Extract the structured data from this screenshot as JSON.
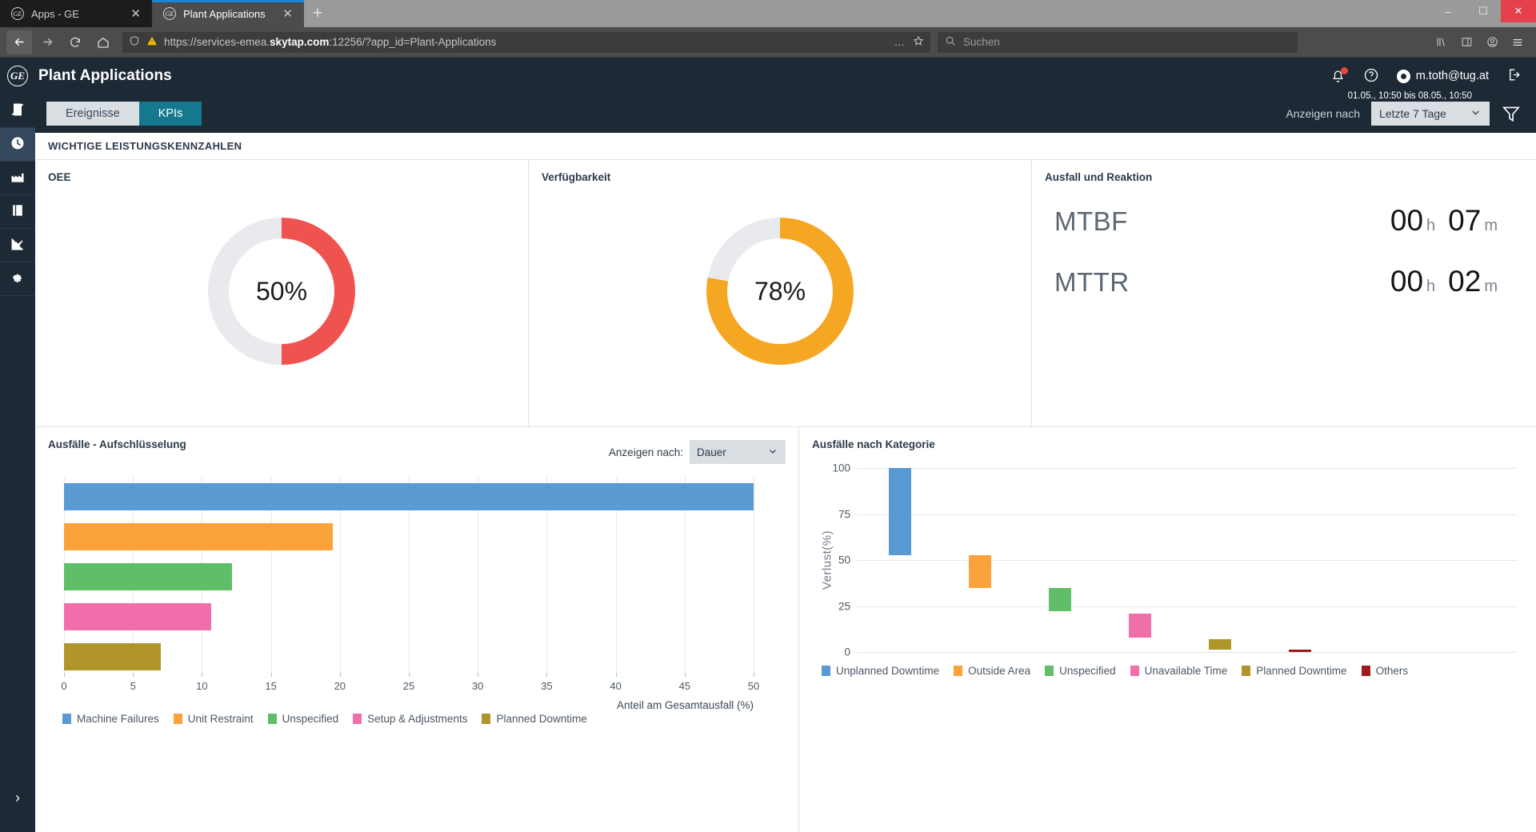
{
  "browser": {
    "tabs": [
      {
        "title": "Apps - GE",
        "favicon": "ge-icon",
        "active": false
      },
      {
        "title": "Plant Applications",
        "favicon": "ge-icon",
        "active": true
      }
    ],
    "new_tab_label": "+",
    "window_controls": {
      "minimize": "–",
      "maximize": "☐",
      "close": "✕"
    },
    "nav": {
      "back": "back-arrow-icon",
      "forward": "forward-arrow-icon",
      "reload": "reload-icon",
      "home": "home-icon"
    },
    "url": {
      "prefix": "https://services-emea.",
      "host": "skytap.com",
      "suffix": ":12256/?app_id=Plant-Applications",
      "full": "https://services-emea.skytap.com:12256/?app_id=Plant-Applications",
      "shield_icon": "shield-icon",
      "warning_icon": "warning-triangle-icon",
      "more_icon": "ellipsis-icon",
      "bookmark_icon": "star-icon"
    },
    "search": {
      "placeholder": "Suchen",
      "icon": "search-icon"
    },
    "toolbar_icons": [
      "library-icon",
      "sidebar-icon",
      "account-icon",
      "menu-icon"
    ]
  },
  "sidebar": {
    "logo": "ge-logo",
    "items": [
      {
        "name": "clipboard",
        "icon": "clipboard-pen-icon",
        "active": false
      },
      {
        "name": "time",
        "icon": "clock-icon",
        "active": true
      },
      {
        "name": "plant",
        "icon": "factory-icon",
        "active": false
      },
      {
        "name": "reports",
        "icon": "book-icon",
        "active": false
      },
      {
        "name": "analysis",
        "icon": "chart-icon",
        "active": false
      },
      {
        "name": "settings",
        "icon": "gear-icon",
        "active": false
      }
    ],
    "expand_label": "›"
  },
  "header": {
    "title": "Plant Applications",
    "notification_icon": "bell-icon",
    "notification_badge": true,
    "help_icon": "help-circle-icon",
    "user_email": "m.toth@tug.at",
    "logout_icon": "logout-icon"
  },
  "subbar": {
    "tabs": [
      {
        "label": "Ereignisse",
        "active": false
      },
      {
        "label": "KPIs",
        "active": true
      }
    ],
    "range_caption": "01.05., 10:50 bis 08.05., 10:50",
    "range_label": "Anzeigen nach",
    "range_value": "Letzte 7 Tage",
    "chevron": "⌄",
    "filter_icon": "funnel-icon"
  },
  "kpi_section": {
    "title": "WICHTIGE LEISTUNGSKENNZAHLEN",
    "oee": {
      "title": "OEE",
      "value_label": "50%"
    },
    "availability": {
      "title": "Verfügbarkeit",
      "value_label": "78%"
    },
    "downtime": {
      "title": "Ausfall und Reaktion",
      "rows": [
        {
          "name": "MTBF",
          "hours": "00",
          "hours_unit": "h",
          "minutes": "07",
          "minutes_unit": "m"
        },
        {
          "name": "MTTR",
          "hours": "00",
          "hours_unit": "h",
          "minutes": "02",
          "minutes_unit": "m"
        }
      ]
    }
  },
  "breakdown_chart": {
    "title": "Ausfälle - Aufschlüsselung",
    "drop_label": "Anzeigen nach:",
    "drop_value": "Dauer",
    "chevron": "⌄"
  },
  "category_chart": {
    "title": "Ausfälle nach Kategorie"
  },
  "colors": {
    "blue": "#599ad3",
    "orange": "#f9a33a",
    "green": "#60bd68",
    "pink": "#f06fab",
    "olive": "#b0962a",
    "darkred": "#9e1b1b",
    "oee_red": "#ef5350",
    "avail_orange": "#f5a623",
    "track": "#e9eaee",
    "accent_teal": "#14788e"
  },
  "chart_data": [
    {
      "type": "bar",
      "orientation": "horizontal",
      "title": "Ausfälle - Aufschlüsselung",
      "xlabel": "Anteil am Gesamtausfall (%)",
      "ylabel": "",
      "xlim": [
        0,
        50
      ],
      "xticks": [
        0,
        5,
        10,
        15,
        20,
        25,
        30,
        35,
        40,
        45,
        50
      ],
      "grid": true,
      "legend_position": "bottom",
      "categories": [
        "Machine Failures",
        "Unit Restraint",
        "Unspecified",
        "Setup & Adjustments",
        "Planned Downtime"
      ],
      "values": [
        50,
        19.5,
        12.2,
        10.7,
        7.0
      ],
      "colors": [
        "#599ad3",
        "#f9a33a",
        "#60bd68",
        "#f06fab",
        "#b0962a"
      ]
    },
    {
      "type": "bar",
      "subtype": "waterfall",
      "title": "Ausfälle nach Kategorie",
      "xlabel": "",
      "ylabel": "Verlust(%)",
      "ylim": [
        0,
        100
      ],
      "yticks": [
        0,
        25,
        50,
        75,
        100
      ],
      "grid": true,
      "legend_position": "bottom",
      "categories": [
        "Unplanned Downtime",
        "Outside Area",
        "Unspecified",
        "Unavailable Time",
        "Planned Downtime",
        "Others"
      ],
      "segments": [
        {
          "name": "Unplanned Downtime",
          "top": 100,
          "bottom": 52.5,
          "color": "#599ad3"
        },
        {
          "name": "Outside Area",
          "top": 52.5,
          "bottom": 35.0,
          "color": "#f9a33a"
        },
        {
          "name": "Unspecified",
          "top": 35.0,
          "bottom": 22.0,
          "color": "#60bd68"
        },
        {
          "name": "Unavailable Time",
          "top": 21.0,
          "bottom": 8.0,
          "color": "#f06fab"
        },
        {
          "name": "Planned Downtime",
          "top": 7.0,
          "bottom": 1.5,
          "color": "#b0962a"
        },
        {
          "name": "Others",
          "top": 1.5,
          "bottom": 0.0,
          "color": "#9e1b1b"
        }
      ]
    }
  ]
}
